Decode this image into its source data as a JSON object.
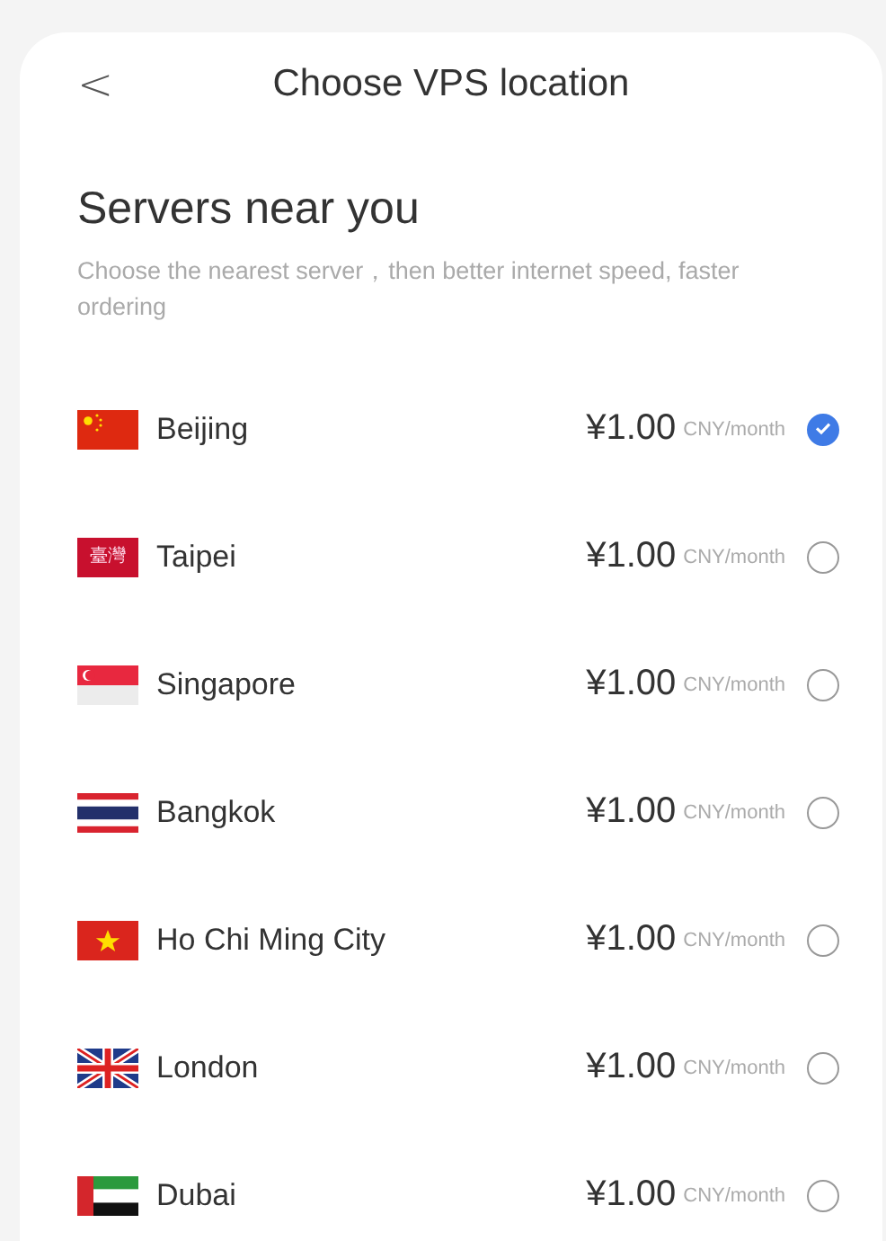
{
  "header": {
    "back": "<",
    "title": "Choose VPS location"
  },
  "section": {
    "title": "Servers near you",
    "subtitle": "Choose the nearest server，then better internet speed, faster ordering"
  },
  "locations": [
    {
      "kind": "cn",
      "name": "Beijing",
      "price": "¥1.00",
      "unit": "CNY/month",
      "selected": true
    },
    {
      "kind": "tw",
      "flag_text": "臺灣",
      "name": "Taipei",
      "price": "¥1.00",
      "unit": "CNY/month",
      "selected": false
    },
    {
      "kind": "sg",
      "name": "Singapore",
      "price": "¥1.00",
      "unit": "CNY/month",
      "selected": false
    },
    {
      "kind": "th",
      "name": "Bangkok",
      "price": "¥1.00",
      "unit": "CNY/month",
      "selected": false
    },
    {
      "kind": "vn",
      "name": "Ho Chi Ming City",
      "price": "¥1.00",
      "unit": "CNY/month",
      "selected": false
    },
    {
      "kind": "gb",
      "name": "London",
      "price": "¥1.00",
      "unit": "CNY/month",
      "selected": false
    },
    {
      "kind": "ae",
      "name": "Dubai",
      "price": "¥1.00",
      "unit": "CNY/month",
      "selected": false
    }
  ]
}
